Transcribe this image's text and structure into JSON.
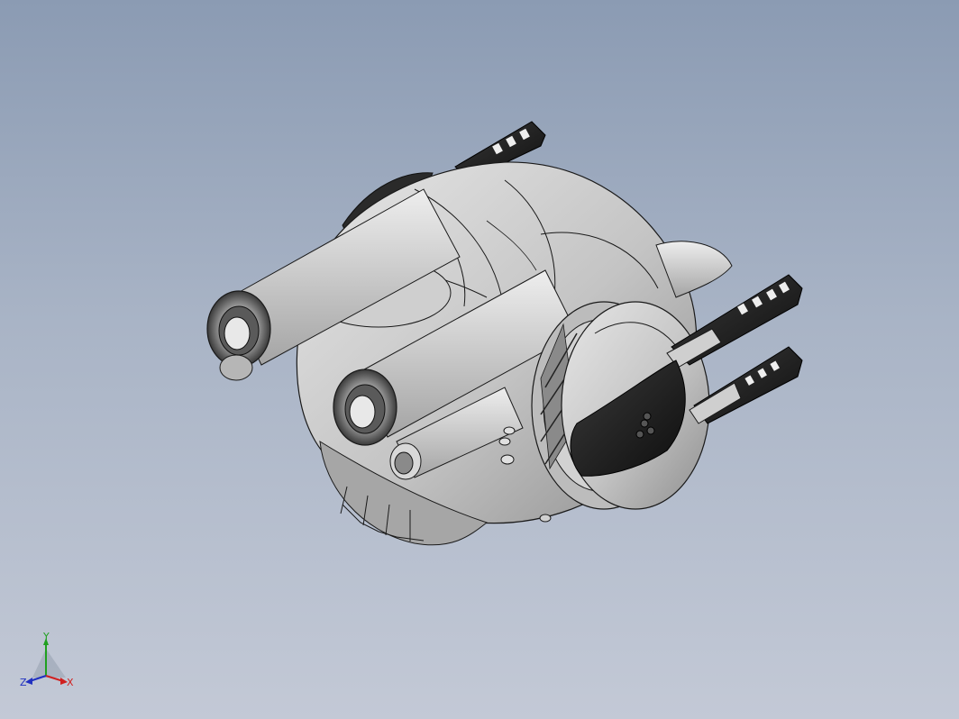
{
  "viewport": {
    "background_top": "#8b9bb3",
    "background_bottom": "#c3c9d6"
  },
  "model": {
    "shading": "shaded-with-edges",
    "body_color": "#c8c8c8",
    "edge_color": "#1a1a1a",
    "dark_part_color": "#1e1e1e"
  },
  "triad": {
    "x_label": "X",
    "y_label": "Y",
    "z_label": "Z",
    "x_color": "#d02020",
    "y_color": "#20a020",
    "z_color": "#2030c0"
  }
}
